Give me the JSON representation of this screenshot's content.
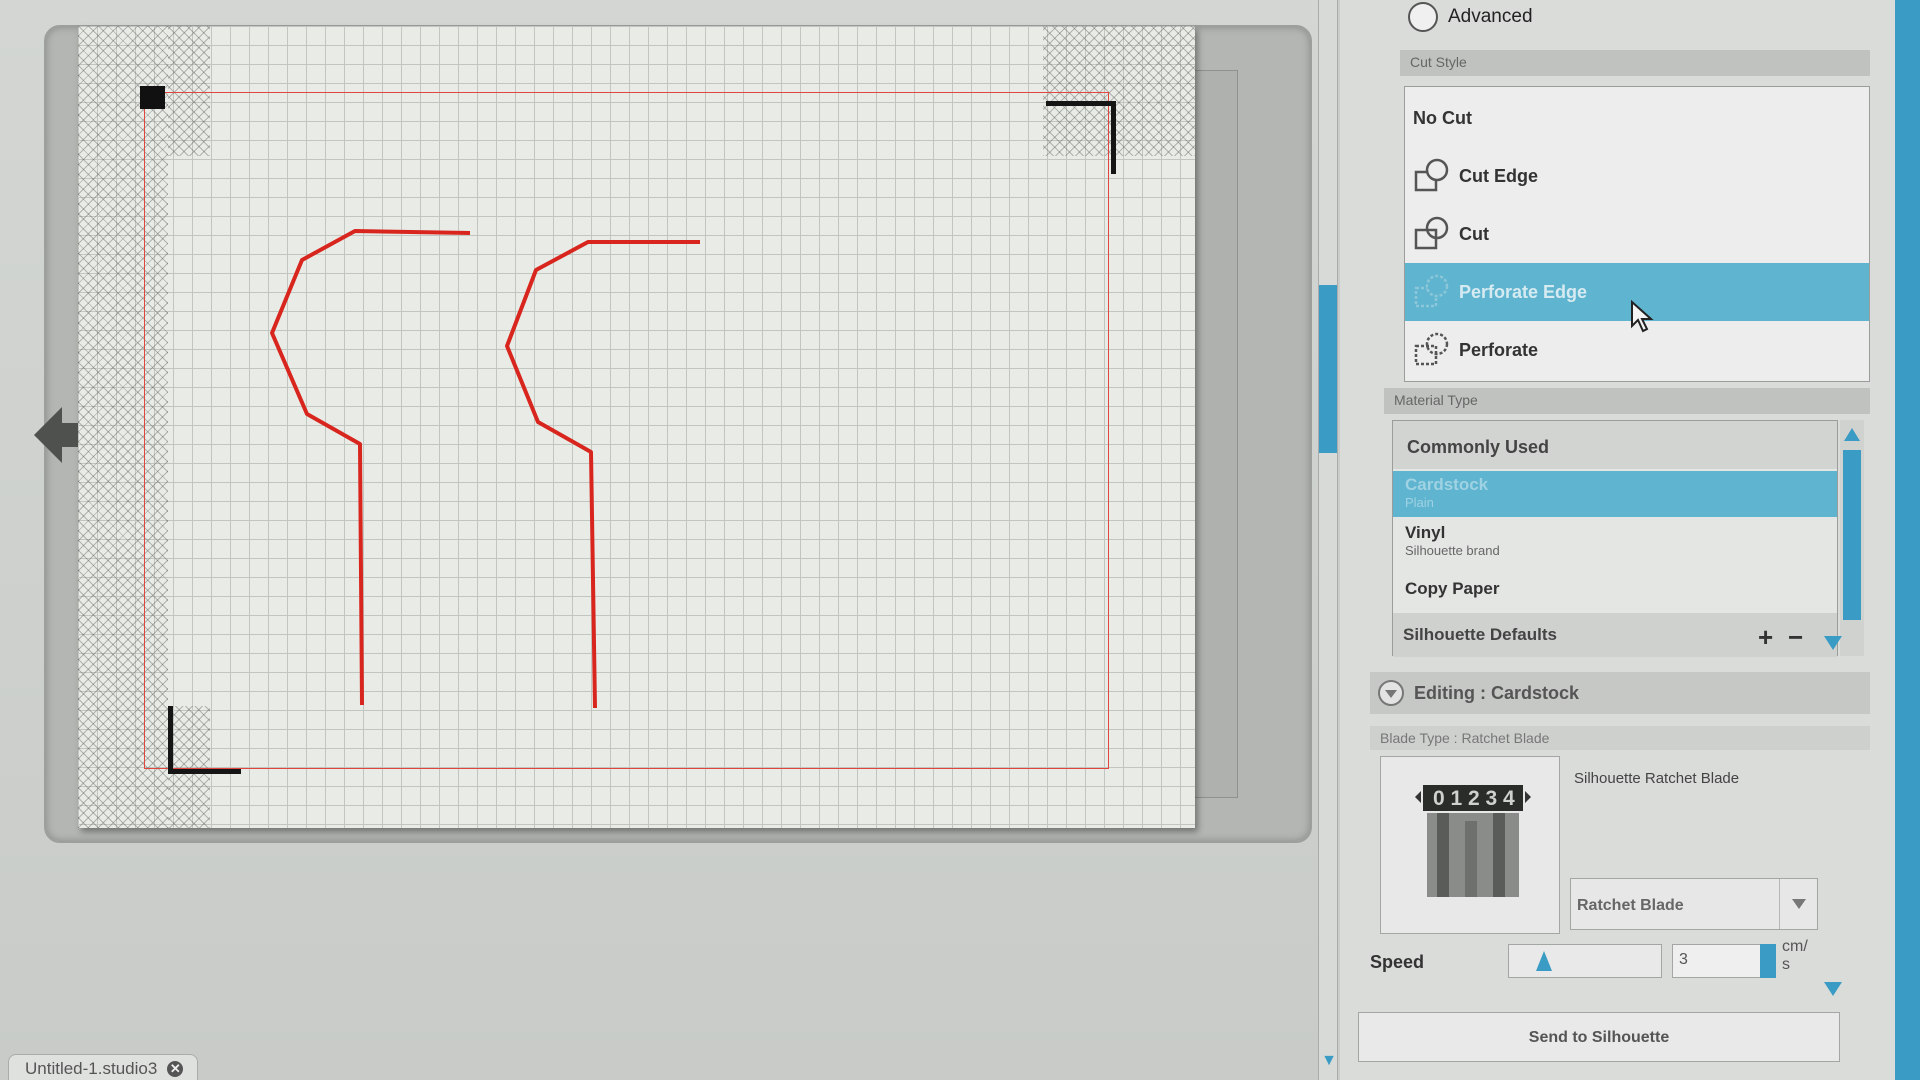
{
  "colors": {
    "accent": "#3a9cc4",
    "selection": "#5fb4cf",
    "cut_line": "#d8261f",
    "mat_background": "#e9ece6"
  },
  "canvas": {
    "nav_arrow_icon": "arrow-left-icon",
    "document_tab": {
      "label": "Untitled-1.studio3",
      "close_icon": "close-icon",
      "close_glyph": "✕"
    }
  },
  "panel": {
    "advanced_label": "Advanced",
    "cut_style": {
      "header": "Cut Style",
      "items": [
        {
          "label": "No Cut",
          "icon": ""
        },
        {
          "label": "Cut Edge",
          "icon": "cut-edge-icon"
        },
        {
          "label": "Cut",
          "icon": "cut-icon"
        },
        {
          "label": "Perforate Edge",
          "icon": "perforate-edge-icon",
          "selected": true
        },
        {
          "label": "Perforate",
          "icon": "perforate-icon"
        }
      ]
    },
    "material_type": {
      "header": "Material Type",
      "group": "Commonly Used",
      "items": [
        {
          "name": "Cardstock",
          "sub": "Plain",
          "selected": true
        },
        {
          "name": "Vinyl",
          "sub": "Silhouette brand"
        },
        {
          "name": "Copy Paper",
          "sub": ""
        }
      ],
      "footer": "Silhouette Defaults",
      "add_label": "+",
      "remove_label": "−"
    },
    "editing": {
      "title": "Editing : Cardstock",
      "blade_type": "Blade Type : Ratchet Blade",
      "blade_name": "Silhouette Ratchet Blade",
      "blade_digits": "0 1 2 3 4",
      "blade_select_value": "Ratchet Blade",
      "speed_label": "Speed",
      "speed_value": "3",
      "speed_fraction": 0.2,
      "speed_unit": "cm/\ns"
    },
    "send_button": "Send to Silhouette"
  }
}
